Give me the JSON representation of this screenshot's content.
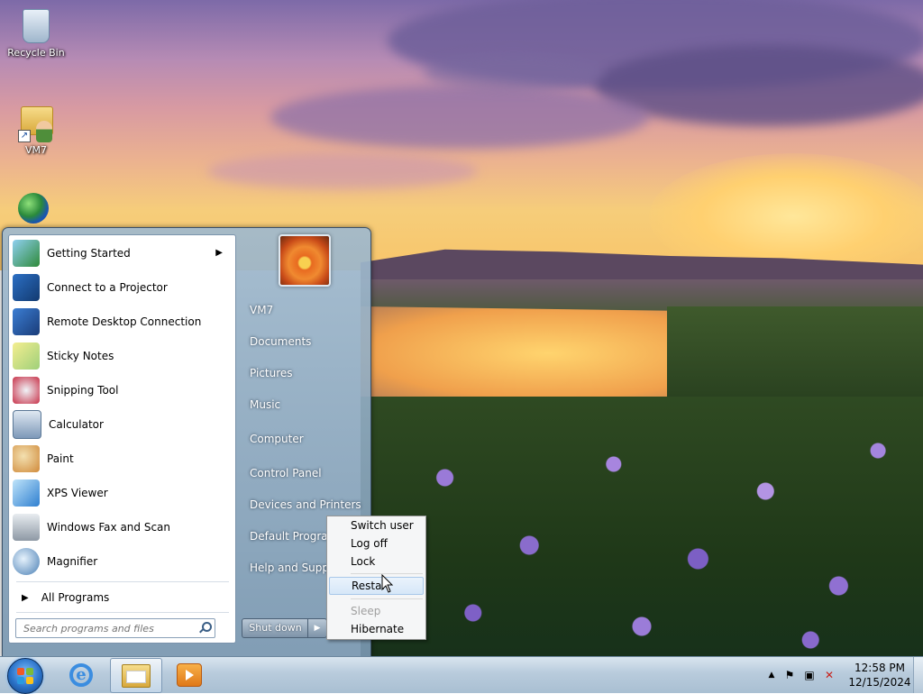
{
  "desktop": {
    "icons": [
      {
        "label": "Recycle Bin",
        "icon": "recycle-bin-icon"
      },
      {
        "label": "VM7",
        "icon": "user-folder-icon"
      },
      {
        "label": "",
        "icon": "network-globe-icon"
      }
    ]
  },
  "start_menu": {
    "programs": [
      {
        "label": "Getting Started",
        "icon": "getting-started-icon",
        "has_submenu": true
      },
      {
        "label": "Connect to a Projector",
        "icon": "projector-icon"
      },
      {
        "label": "Remote Desktop Connection",
        "icon": "remote-desktop-icon"
      },
      {
        "label": "Sticky Notes",
        "icon": "sticky-notes-icon"
      },
      {
        "label": "Snipping Tool",
        "icon": "snipping-tool-icon"
      },
      {
        "label": "Calculator",
        "icon": "calculator-icon"
      },
      {
        "label": "Paint",
        "icon": "paint-icon"
      },
      {
        "label": "XPS Viewer",
        "icon": "xps-viewer-icon"
      },
      {
        "label": "Windows Fax and Scan",
        "icon": "fax-scan-icon"
      },
      {
        "label": "Magnifier",
        "icon": "magnifier-icon"
      }
    ],
    "all_programs": "All Programs",
    "search_placeholder": "Search programs and files",
    "right_links": [
      {
        "label": "VM7"
      },
      {
        "label": "Documents"
      },
      {
        "label": "Pictures"
      },
      {
        "label": "Music"
      },
      {
        "label": "Computer"
      },
      {
        "label": "Control Panel"
      },
      {
        "label": "Devices and Printers"
      },
      {
        "label": "Default Programs"
      },
      {
        "label": "Help and Support"
      }
    ],
    "shutdown_label": "Shut down",
    "shutdown_submenu": [
      {
        "label": "Switch user",
        "state": "normal"
      },
      {
        "label": "Log off",
        "state": "normal"
      },
      {
        "label": "Lock",
        "state": "normal"
      },
      {
        "label": "Restart",
        "state": "hover"
      },
      {
        "label": "Sleep",
        "state": "disabled"
      },
      {
        "label": "Hibernate",
        "state": "normal"
      }
    ]
  },
  "taskbar": {
    "pinned": [
      {
        "name": "internet-explorer",
        "icon": "internet-explorer-icon",
        "active": false
      },
      {
        "name": "windows-explorer",
        "icon": "windows-explorer-icon",
        "active": true
      },
      {
        "name": "windows-media-player",
        "icon": "media-player-icon",
        "active": false
      }
    ],
    "clock": {
      "time": "12:58 PM",
      "date": "12/15/2024"
    }
  },
  "colors": {
    "taskbar": "#b8cbdc",
    "start_orb": "#2a72c8",
    "hover_highlight": "#d6e7f8"
  }
}
